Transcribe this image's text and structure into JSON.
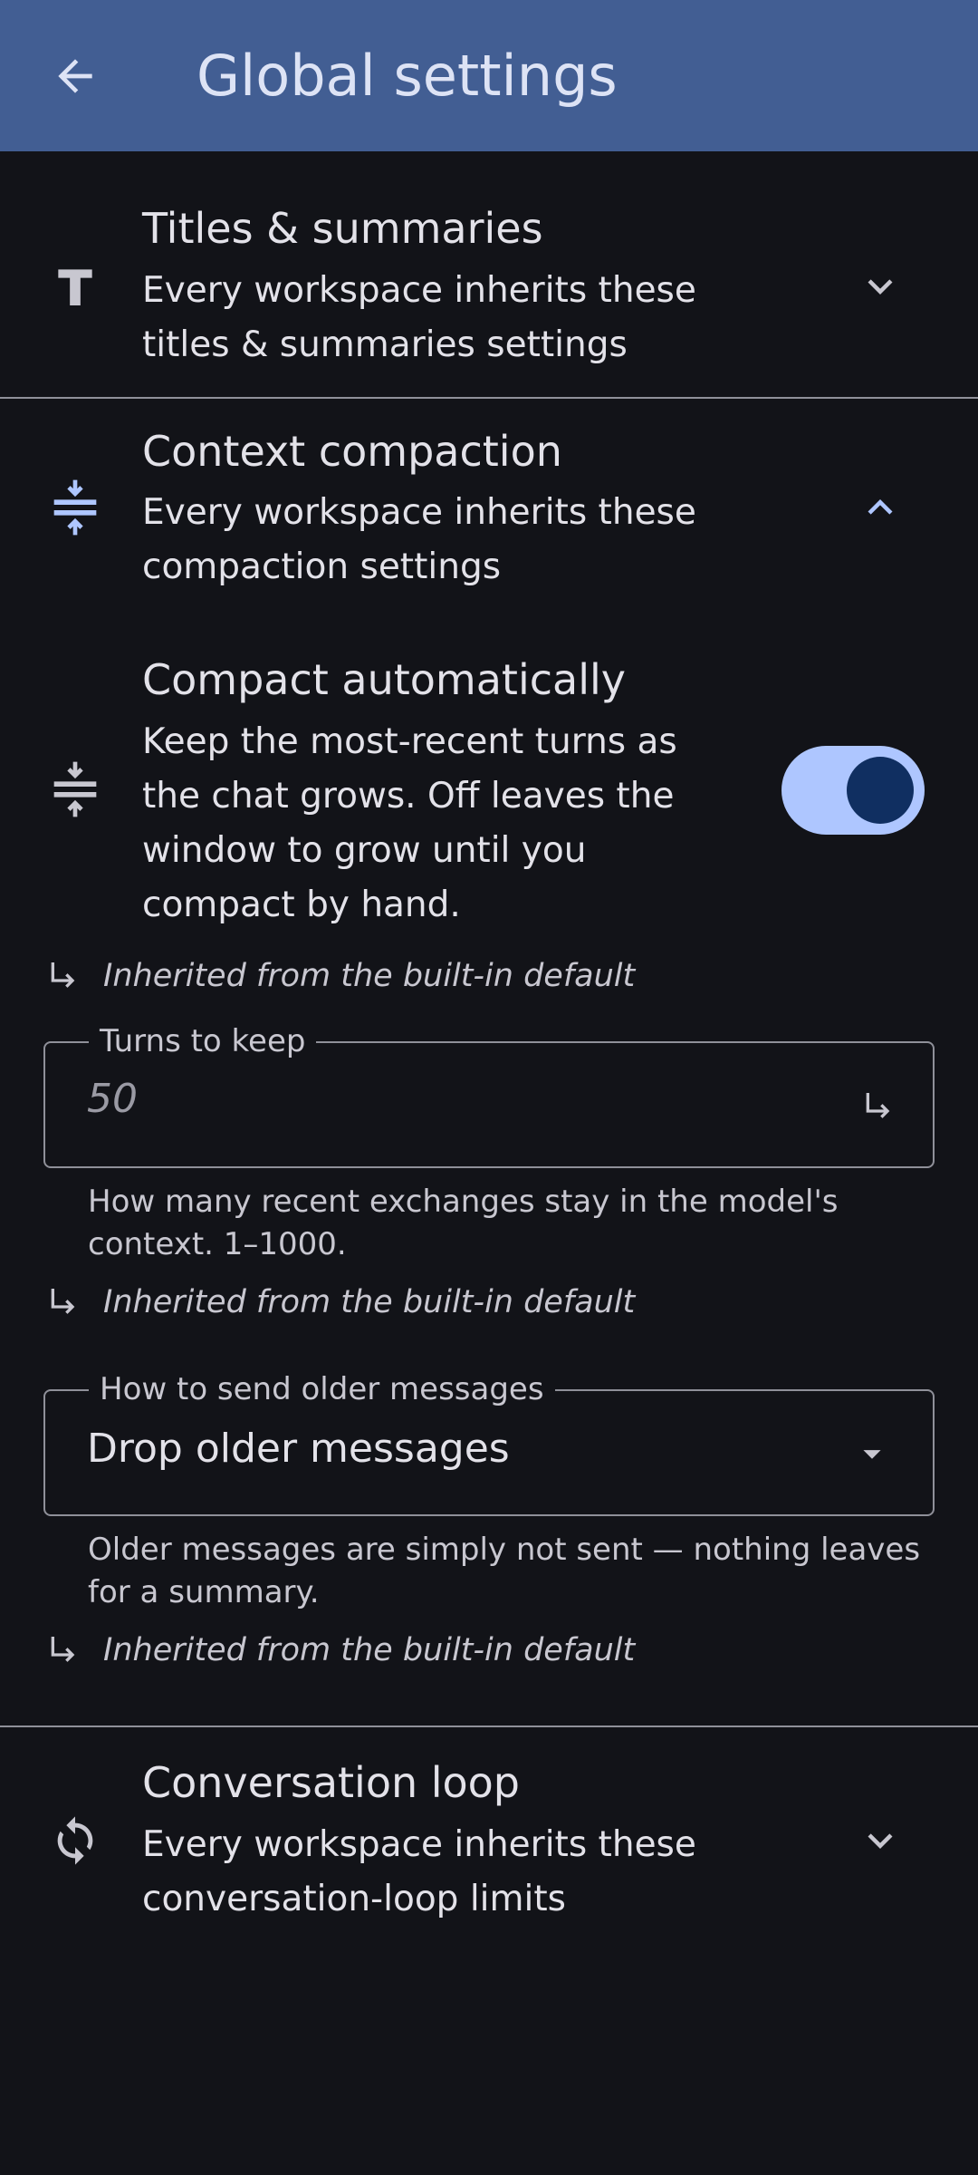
{
  "appbar": {
    "title": "Global settings",
    "back_icon": "arrow-left-icon"
  },
  "sections": {
    "titles": {
      "title": "Titles & summaries",
      "subtitle": "Every workspace inherits these titles & summaries settings",
      "icon": "text-t-icon",
      "expanded": false
    },
    "compaction": {
      "title": "Context compaction",
      "subtitle": "Every workspace inherits these compaction settings",
      "icon": "compress-icon",
      "expanded": true,
      "auto": {
        "title": "Compact automatically",
        "subtitle": "Keep the most-recent turns as the chat grows. Off leaves the window to grow until you compact by hand.",
        "enabled": true,
        "inherited": "Inherited from the built-in default"
      },
      "turns": {
        "label": "Turns to keep",
        "value": "50",
        "helper": "How many recent exchanges stay in the model's context. 1–1000.",
        "inherited": "Inherited from the built-in default"
      },
      "send_mode": {
        "label": "How to send older messages",
        "value": "Drop older messages",
        "helper": "Older messages are simply not sent — nothing leaves for a summary.",
        "inherited": "Inherited from the built-in default"
      }
    },
    "loop": {
      "title": "Conversation loop",
      "subtitle": "Every workspace inherits these conversation-loop limits",
      "icon": "sync-icon",
      "expanded": false
    }
  },
  "colors": {
    "appbar": "#425e93",
    "background": "#121318",
    "accent": "#aec6ff",
    "toggle_knob": "#102f61",
    "divider": "#8f9099"
  }
}
